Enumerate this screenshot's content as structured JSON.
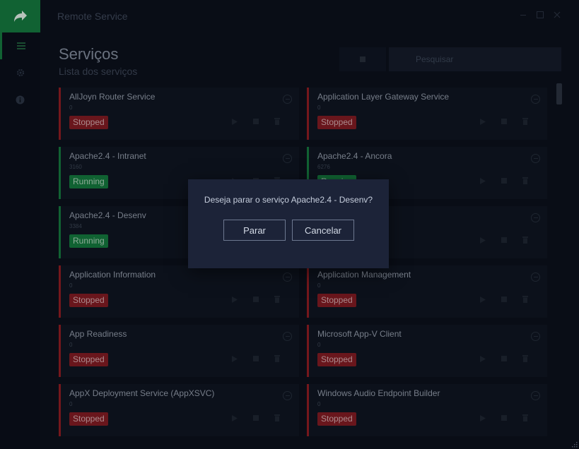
{
  "app": {
    "title": "Remote Service"
  },
  "header": {
    "title": "Serviços",
    "subtitle": "Lista dos serviços"
  },
  "search": {
    "placeholder": "Pesquisar"
  },
  "icons": {
    "logo": "share-arrow-icon",
    "sidebar": [
      "list-icon",
      "gear-icon",
      "info-icon"
    ],
    "window": [
      "minimize-icon",
      "maximize-icon",
      "close-icon"
    ],
    "card_actions": [
      "play-icon",
      "stop-icon",
      "trash-icon"
    ]
  },
  "colors": {
    "accent": "#14743c",
    "stopped": "#7c1b22",
    "running": "#13743b",
    "dialog": "#1c2338"
  },
  "services": [
    {
      "name": "AllJoyn Router Service",
      "pid": "0",
      "status": "Stopped"
    },
    {
      "name": "Application Layer Gateway Service",
      "pid": "0",
      "status": "Stopped"
    },
    {
      "name": "Apache2.4 - Intranet",
      "pid": "3160",
      "status": "Running"
    },
    {
      "name": "Apache2.4 - Ancora",
      "pid": "6276",
      "status": "Running"
    },
    {
      "name": "Apache2.4 - Desenv",
      "pid": "3384",
      "status": "Running"
    },
    {
      "name": "",
      "pid": "",
      "status": ""
    },
    {
      "name": "Application Information",
      "pid": "0",
      "status": "Stopped"
    },
    {
      "name": "Application Management",
      "pid": "0",
      "status": "Stopped"
    },
    {
      "name": "App Readiness",
      "pid": "0",
      "status": "Stopped"
    },
    {
      "name": "Microsoft App-V Client",
      "pid": "0",
      "status": "Stopped"
    },
    {
      "name": "AppX Deployment Service (AppXSVC)",
      "pid": "0",
      "status": "Stopped"
    },
    {
      "name": "Windows Audio Endpoint Builder",
      "pid": "0",
      "status": "Stopped"
    }
  ],
  "dialog": {
    "message": "Deseja parar o serviço Apache2.4 - Desenv?",
    "confirm_label": "Parar",
    "cancel_label": "Cancelar"
  }
}
